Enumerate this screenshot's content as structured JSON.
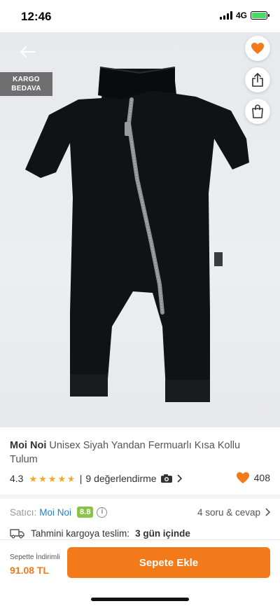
{
  "status_bar": {
    "time": "12:46",
    "network": "4G"
  },
  "badge": {
    "line1": "KARGO",
    "line2": "BEDAVA"
  },
  "product": {
    "brand": "Moi Noi",
    "name": "Unisex Siyah Yandan Fermuarlı Kısa Kollu Tulum",
    "rating": "4.3",
    "stars_value": 4.3,
    "review_text": "9 değerlendirme",
    "favorites": "408"
  },
  "seller": {
    "label": "Satıcı:",
    "name": "Moi Noi",
    "score": "8.8",
    "qa": "4 soru & cevap"
  },
  "delivery": {
    "prefix": "Tahmini kargoya teslim:",
    "value": "3 gün içinde"
  },
  "bottom": {
    "price_label": "Sepette İndirimli",
    "price": "91.08 TL",
    "cart_button": "Sepete Ekle"
  },
  "colors": {
    "accent": "#f27a1a",
    "link": "#1f7fd8",
    "score_badge": "#8bc34a"
  }
}
